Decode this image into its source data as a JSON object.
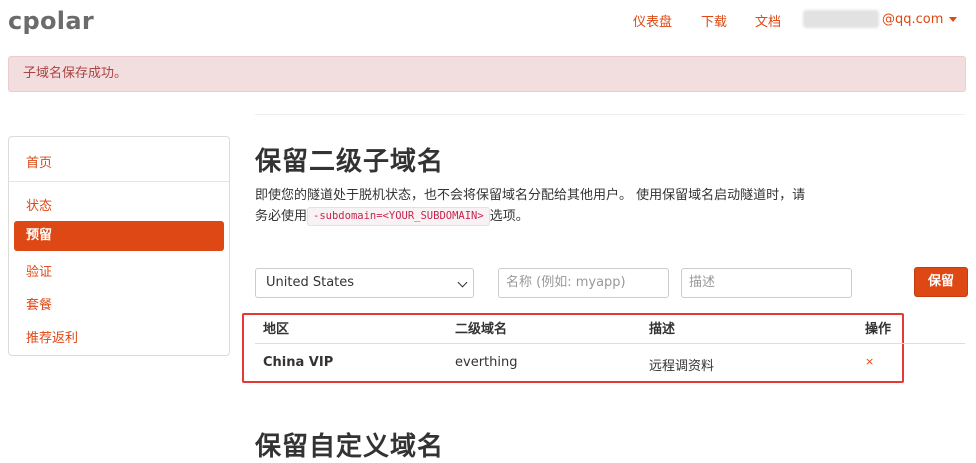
{
  "app": {
    "logo": "cpolar"
  },
  "nav": {
    "dashboard": "仪表盘",
    "download": "下载",
    "docs": "文档",
    "user_email_suffix": "@qq.com"
  },
  "alert": {
    "message": "子域名保存成功。"
  },
  "sidebar": {
    "items": [
      {
        "label": "首页"
      },
      {
        "label": "状态"
      },
      {
        "label": "预留",
        "active": true
      },
      {
        "label": "验证"
      },
      {
        "label": "套餐"
      },
      {
        "label": "推荐返利"
      }
    ]
  },
  "main": {
    "title": "保留二级子域名",
    "desc_part1": "即使您的隧道处于脱机状态，也不会将保留域名分配给其他用户。 使用保留域名启动隧道时，请务必使用",
    "desc_code": "-subdomain=<YOUR_SUBDOMAIN>",
    "desc_part2": "选项。",
    "form": {
      "region_selected": "United States",
      "name_placeholder": "名称 (例如: myapp)",
      "desc_placeholder": "描述",
      "save_label": "保留"
    },
    "table": {
      "headers": [
        "地区",
        "二级域名",
        "描述",
        "操作"
      ],
      "rows": [
        {
          "region": "China VIP",
          "subdomain": "everthing",
          "description": "远程调资料",
          "action": "×"
        }
      ]
    },
    "section2_title": "保留自定义域名"
  },
  "colors": {
    "accent": "#dd4814",
    "alert_bg": "#f2dede",
    "alert_text": "#a94442",
    "highlight_border": "#e53935"
  }
}
